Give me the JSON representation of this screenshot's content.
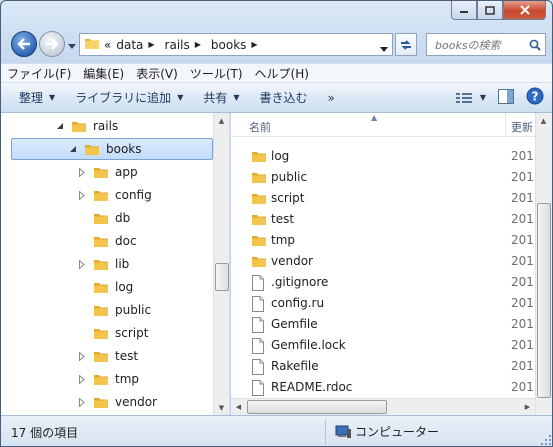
{
  "window": {
    "min_icon": "minimize-icon",
    "max_icon": "maximize-icon",
    "close_icon": "close-icon"
  },
  "nav": {
    "breadcrumb_prefix": "«",
    "breadcrumb": [
      "data",
      "rails",
      "books"
    ],
    "search_placeholder": "booksの検索"
  },
  "menu": [
    "ファイル(F)",
    "編集(E)",
    "表示(V)",
    "ツール(T)",
    "ヘルプ(H)"
  ],
  "commands": {
    "organize": "整理",
    "include_library": "ライブラリに追加",
    "share": "共有",
    "burn": "書き込む",
    "more": "»"
  },
  "tree": [
    {
      "label": "rails",
      "expanded": true,
      "has_children": true,
      "depth": 0,
      "selected": false
    },
    {
      "label": "books",
      "expanded": true,
      "has_children": true,
      "depth": 1,
      "selected": true
    },
    {
      "label": "app",
      "expanded": false,
      "has_children": true,
      "depth": 2,
      "selected": false
    },
    {
      "label": "config",
      "expanded": false,
      "has_children": true,
      "depth": 2,
      "selected": false
    },
    {
      "label": "db",
      "expanded": false,
      "has_children": false,
      "depth": 2,
      "selected": false
    },
    {
      "label": "doc",
      "expanded": false,
      "has_children": false,
      "depth": 2,
      "selected": false
    },
    {
      "label": "lib",
      "expanded": false,
      "has_children": true,
      "depth": 2,
      "selected": false
    },
    {
      "label": "log",
      "expanded": false,
      "has_children": false,
      "depth": 2,
      "selected": false
    },
    {
      "label": "public",
      "expanded": false,
      "has_children": false,
      "depth": 2,
      "selected": false
    },
    {
      "label": "script",
      "expanded": false,
      "has_children": false,
      "depth": 2,
      "selected": false
    },
    {
      "label": "test",
      "expanded": false,
      "has_children": true,
      "depth": 2,
      "selected": false
    },
    {
      "label": "tmp",
      "expanded": false,
      "has_children": true,
      "depth": 2,
      "selected": false
    },
    {
      "label": "vendor",
      "expanded": false,
      "has_children": true,
      "depth": 2,
      "selected": false
    }
  ],
  "list": {
    "col_name": "名前",
    "col_date": "更新",
    "files": [
      {
        "name": "log",
        "type": "folder",
        "date": "201"
      },
      {
        "name": "public",
        "type": "folder",
        "date": "201"
      },
      {
        "name": "script",
        "type": "folder",
        "date": "201"
      },
      {
        "name": "test",
        "type": "folder",
        "date": "201"
      },
      {
        "name": "tmp",
        "type": "folder",
        "date": "201"
      },
      {
        "name": "vendor",
        "type": "folder",
        "date": "201"
      },
      {
        "name": ".gitignore",
        "type": "file",
        "date": "201"
      },
      {
        "name": "config.ru",
        "type": "file",
        "date": "201"
      },
      {
        "name": "Gemfile",
        "type": "file",
        "date": "201"
      },
      {
        "name": "Gemfile.lock",
        "type": "file",
        "date": "201"
      },
      {
        "name": "Rakefile",
        "type": "file",
        "date": "201"
      },
      {
        "name": "README.rdoc",
        "type": "file",
        "date": "201"
      }
    ]
  },
  "status": {
    "count": "17 個の項目",
    "location": "コンピューター"
  },
  "colors": {
    "folder": "#f3c64b",
    "selection": "#c1dcfc",
    "accent": "#2b65b5"
  }
}
